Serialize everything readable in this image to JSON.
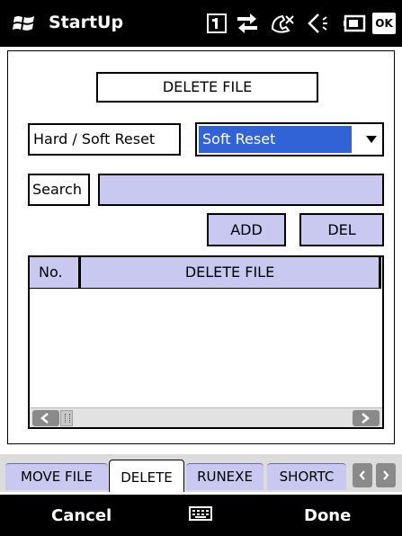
{
  "titlebar": {
    "app_title": "StartUp",
    "icons": [
      "windows-logo-icon",
      "sim-1-icon",
      "connectivity-icon",
      "phone-missed-icon",
      "volume-icon",
      "battery-icon",
      "ok-icon"
    ],
    "ok_label": "OK"
  },
  "form": {
    "title": "DELETE FILE",
    "reset_label": "Hard / Soft Reset",
    "reset_value": "Soft Reset",
    "search_label": "Search",
    "search_value": "",
    "add_label": "ADD",
    "del_label": "DEL"
  },
  "list": {
    "columns": [
      "No.",
      "DELETE FILE"
    ],
    "rows": []
  },
  "tabs": {
    "items": [
      "MOVE FILE",
      "DELETE",
      "RUNEXE",
      "SHORTC"
    ],
    "active_index": 1
  },
  "softkeys": {
    "left": "Cancel",
    "right": "Done"
  },
  "colors": {
    "accent_lavender": "#c8c8f0",
    "selection_blue": "#3163d6",
    "bar_black": "#000000"
  }
}
